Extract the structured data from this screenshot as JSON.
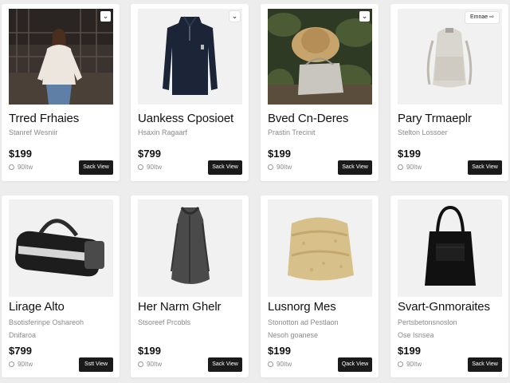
{
  "products": [
    {
      "title": "Trred Frhaies",
      "subtitle": "Stanref Wesniir",
      "subtitle2": "",
      "price": "$199",
      "stock": "90Itw",
      "button": "Sack View",
      "corner": "chevron-down-icon",
      "corner_label": "",
      "image": "woman-model-photo"
    },
    {
      "title": "Uankess Cposioet",
      "subtitle": "Hsaxin Ragaarf",
      "subtitle2": "",
      "price": "$799",
      "stock": "90Itw",
      "button": "Sack View",
      "corner": "chevron-down-icon",
      "corner_label": "",
      "image": "navy-sweater-photo"
    },
    {
      "title": "Bved Cn-Deres",
      "subtitle": "Prastin Trecinit",
      "subtitle2": "",
      "price": "$199",
      "stock": "90Itw",
      "button": "Sack View",
      "corner": "chevron-down-icon",
      "corner_label": "",
      "image": "straw-hat-bag-photo"
    },
    {
      "title": "Pary Trmaeplr",
      "subtitle": "Stelton Lossoer",
      "subtitle2": "",
      "price": "$199",
      "stock": "90Itw",
      "button": "Sack View",
      "corner": "",
      "corner_label": "Emnae ⇨",
      "image": "backpack-photo"
    },
    {
      "title": "Lirage Alto",
      "subtitle": "Bsotisferinpe Oshareoh",
      "subtitle2": "Dnifaroa",
      "price": "$799",
      "stock": "90Itw",
      "button": "Sstt View",
      "corner": "",
      "corner_label": "",
      "image": "duffel-bag-photo"
    },
    {
      "title": "Her Narm Ghelr",
      "subtitle": "Stsoreef Prcobls",
      "subtitle2": "",
      "price": "$199",
      "stock": "90Itw",
      "button": "Sack View",
      "corner": "",
      "corner_label": "",
      "image": "grey-coat-photo"
    },
    {
      "title": "Lusnorg Mes",
      "subtitle": "Stonotton ad Pestlaon",
      "subtitle2": "Nesoh goanese",
      "price": "$199",
      "stock": "90Itw",
      "button": "Qack View",
      "corner": "",
      "corner_label": "",
      "image": "woven-pouch-photo"
    },
    {
      "title": "Svart-Gnmoraites",
      "subtitle": "Pertsbetonsnoslon",
      "subtitle2": "Ose Isnsea",
      "price": "$199",
      "stock": "90Itw",
      "button": "Sack View",
      "corner": "",
      "corner_label": "",
      "image": "black-tote-photo"
    }
  ]
}
